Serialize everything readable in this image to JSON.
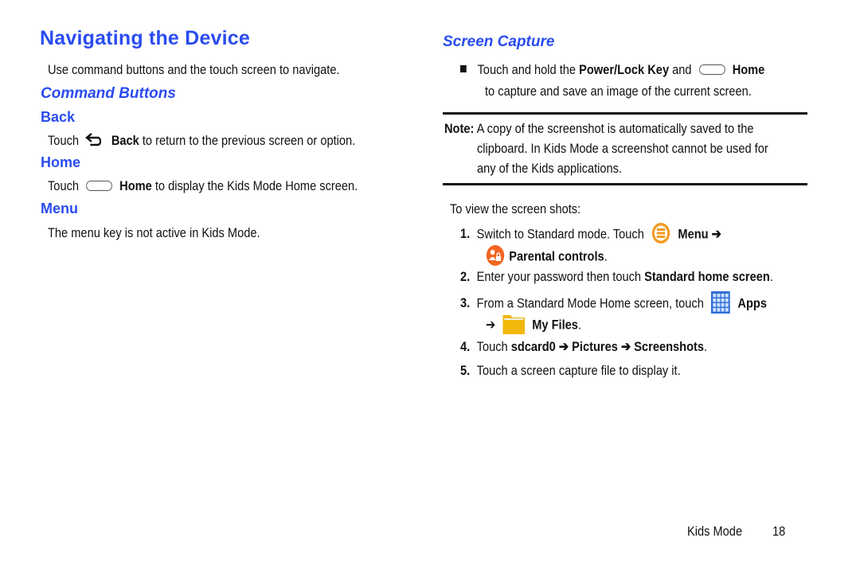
{
  "left": {
    "title": "Navigating the Device",
    "intro": "Use command buttons and the touch screen to navigate.",
    "command_buttons_heading": "Command Buttons",
    "back": {
      "heading": "Back",
      "pre": "Touch",
      "icon": "back-arrow-icon",
      "bold": "Back",
      "post": "to return to the previous screen or option."
    },
    "home": {
      "heading": "Home",
      "pre": "Touch",
      "icon": "home-key-icon",
      "bold": "Home",
      "post": "to display the Kids Mode Home screen."
    },
    "menu": {
      "heading": "Menu",
      "text": "The menu key is not active in Kids Mode."
    }
  },
  "right": {
    "heading": "Screen Capture",
    "bullet": {
      "pre": "Touch and hold the",
      "bold1": "Power/Lock Key",
      "mid": "and",
      "bold2": "Home",
      "line2": "to capture and save an image of the current screen."
    },
    "note": {
      "label": "Note:",
      "line1": "A copy of the screenshot is automatically saved to the",
      "line2": "clipboard. In Kids Mode a screenshot cannot be used for",
      "line3": "any of the Kids applications."
    },
    "view_intro": "To view the screen shots:",
    "steps": [
      {
        "num": "1.",
        "pre": "Switch to Standard mode. Touch",
        "bold": "Menu ➔",
        "line2_bold": "Parental controls",
        "line2_post": "."
      },
      {
        "num": "2.",
        "pre": "Enter your password then touch",
        "bold": "Standard home screen",
        "post": "."
      },
      {
        "num": "3.",
        "pre": "From a Standard Mode Home screen, touch",
        "bold": "Apps",
        "line2_arrow": "➔",
        "line2_bold": "My Files",
        "line2_post": "."
      },
      {
        "num": "4.",
        "pre": "Touch",
        "bold": "sdcard0 ➔ Pictures ➔ Screenshots",
        "post": "."
      },
      {
        "num": "5.",
        "pre": "Touch a screen capture file to display it."
      }
    ]
  },
  "footer": {
    "section": "Kids Mode",
    "page": "18"
  },
  "colors": {
    "heading_blue": "#2a4cf0",
    "menu_icon_orange": "#f29a1f",
    "parental_icon_orange": "#f26522",
    "apps_icon_blue": "#2f6fd6",
    "folder_yellow": "#f0b400"
  }
}
